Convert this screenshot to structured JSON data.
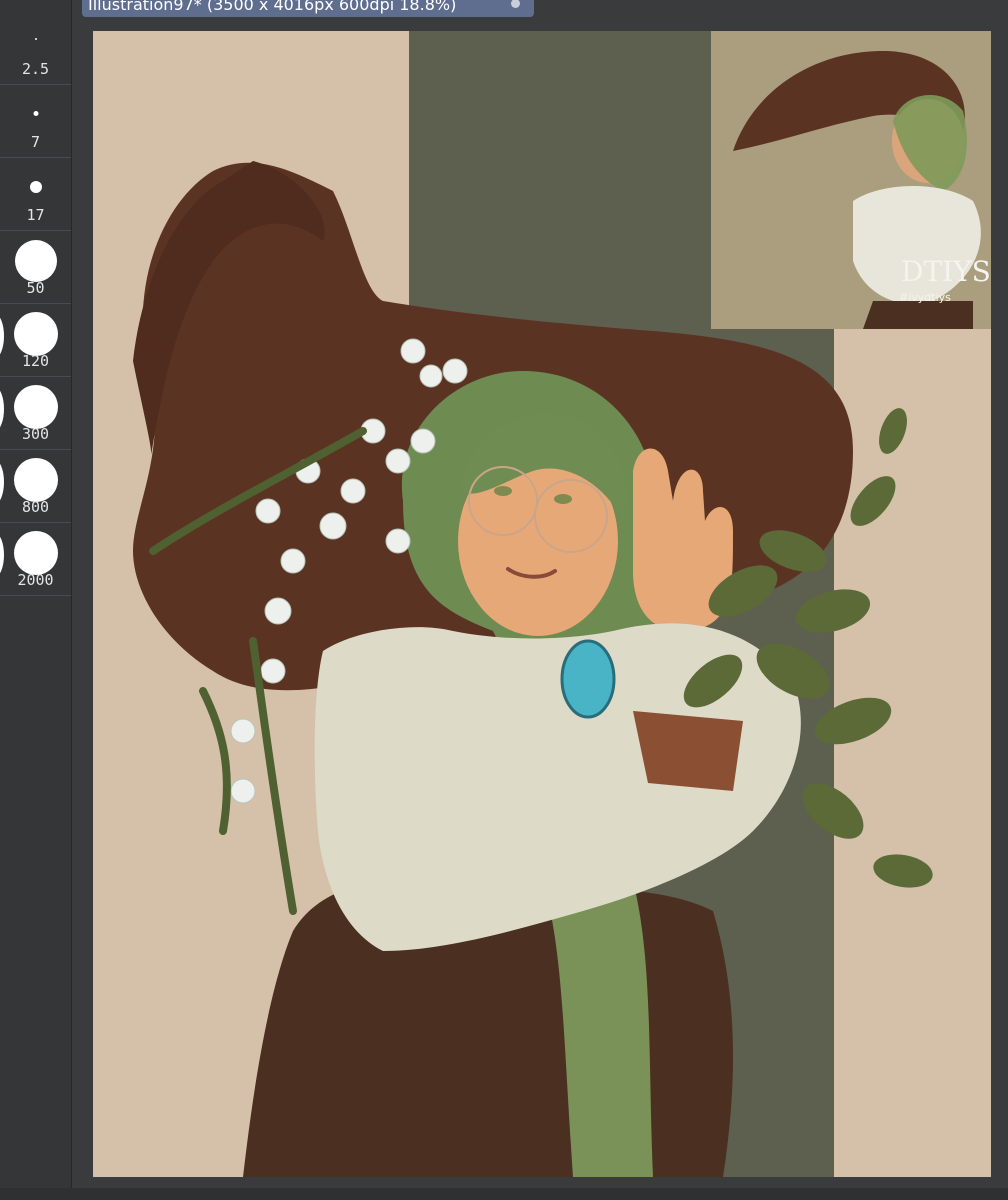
{
  "document_tab": {
    "title": "Illustration97* (3500 x 4016px 600dpi 18.8%)"
  },
  "brush_sizes": [
    "2.5",
    "7",
    "17",
    "50",
    "120",
    "300",
    "800",
    "2000"
  ],
  "canvas": {
    "background_color": "#d5c1aa",
    "stripe_color": "#5d5f4f",
    "reference_text": "DTIYS",
    "reference_hashtag": "#ivydtiys"
  }
}
